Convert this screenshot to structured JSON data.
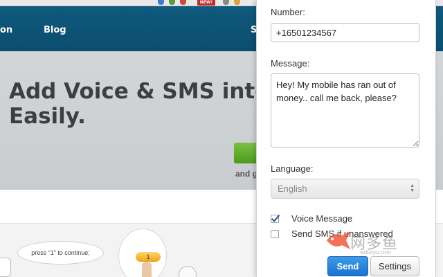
{
  "site": {
    "nav_items": [
      "on",
      "Blog",
      "S"
    ],
    "hero_heading": "Add Voice & SMS into y\nEasily.",
    "hero_subtext": "and g",
    "bubble_text": "press “1” to continue;",
    "key_label": "1",
    "new_badge": "NEW!"
  },
  "popup": {
    "number_label": "Number:",
    "number_value": "+16501234567",
    "message_label": "Message:",
    "message_value": "Hey! My mobile has ran out of money.. call me back, please?",
    "language_label": "Language:",
    "language_selected": "English",
    "voice_message": {
      "label": "Voice Message",
      "checked": true
    },
    "send_sms": {
      "label": "Send SMS if unanswered",
      "checked": false
    },
    "send_button": "Send",
    "settings_button": "Settings"
  },
  "watermark": {
    "chars": "网多鱼",
    "domain": "wduoyu.com"
  },
  "colors": {
    "nav": "#0f5a7e",
    "send": "#1a73d1",
    "green": "#4c9a1e"
  }
}
